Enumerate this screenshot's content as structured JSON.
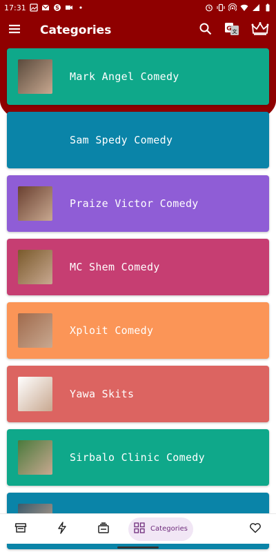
{
  "status_bar": {
    "time": "17:31"
  },
  "app_bar": {
    "title": "Categories"
  },
  "categories": [
    {
      "label": "Mark Angel Comedy",
      "color": "#0fa88a",
      "has_thumb": true
    },
    {
      "label": "Sam Spedy Comedy",
      "color": "#0a84a8",
      "has_thumb": false
    },
    {
      "label": "Praize Victor Comedy",
      "color": "#8f5dd6",
      "has_thumb": true
    },
    {
      "label": "MC Shem Comedy",
      "color": "#c63e72",
      "has_thumb": true
    },
    {
      "label": "Xploit Comedy",
      "color": "#fb9557",
      "has_thumb": true
    },
    {
      "label": "Yawa Skits",
      "color": "#dc6461",
      "has_thumb": true
    },
    {
      "label": "Sirbalo Clinic Comedy",
      "color": "#0fa88a",
      "has_thumb": true
    },
    {
      "label": "",
      "color": "#0a84a8",
      "has_thumb": true
    }
  ],
  "bottom_nav": {
    "items": [
      {
        "icon": "store-icon"
      },
      {
        "icon": "lightning-icon"
      },
      {
        "icon": "stack-icon"
      },
      {
        "icon": "grid-icon",
        "label": "Categories",
        "active": true
      },
      {
        "icon": "heart-icon"
      }
    ]
  }
}
